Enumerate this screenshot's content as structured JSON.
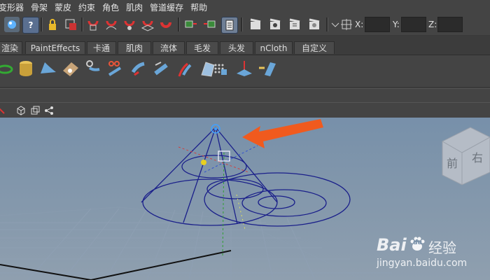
{
  "menubar": {
    "items": [
      "变形器",
      "骨架",
      "蒙皮",
      "约束",
      "角色",
      "肌肉",
      "管道缓存",
      "帮助"
    ]
  },
  "toolbar": {
    "help_label": "?",
    "x_label": "X:",
    "y_label": "Y:",
    "z_label": "Z:",
    "x_value": "",
    "y_value": "",
    "z_value": ""
  },
  "shelf_tabs": [
    "渲染",
    "PaintEffects",
    "卡通",
    "肌肉",
    "流体",
    "毛发",
    "头发",
    "nCloth",
    "自定义"
  ],
  "view_cube": {
    "front_label": "前",
    "right_label": "右"
  },
  "colors": {
    "accent_arrow": "#f05a1e",
    "cone_wire": "#1a1f8a",
    "viewport_top": "#7790aa",
    "grid_line": "#8a9aae"
  },
  "watermark": {
    "brand": "Bai",
    "paw": "du",
    "cn": "经验",
    "url": "jingyan.baidu.com"
  }
}
